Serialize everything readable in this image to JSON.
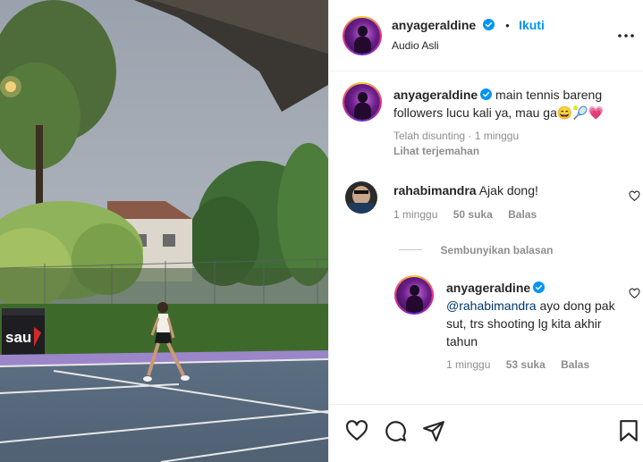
{
  "header": {
    "username": "anyageraldine",
    "follow_label": "Ikuti",
    "separator": "•",
    "audio_label": "Audio Asli"
  },
  "caption": {
    "username": "anyageraldine",
    "text": "main tennis bareng followers lucu kali ya, mau ga😄🎾💗",
    "edited_label": "Telah disunting",
    "time": "1 minggu",
    "translate_label": "Lihat terjemahan"
  },
  "comments": [
    {
      "username": "rahabimandra",
      "text": "Ajak dong!",
      "time": "1 minggu",
      "likes": "50 suka",
      "reply_label": "Balas"
    }
  ],
  "hide_replies_label": "Sembunyikan balasan",
  "replies": [
    {
      "username": "anyageraldine",
      "mention": "@rahabimandra",
      "text": "ayo dong pak sut, trs shooting lg kita akhir tahun",
      "time": "1 minggu",
      "likes": "53 suka",
      "reply_label": "Balas"
    }
  ],
  "media": {
    "banner_text": "sau"
  },
  "icons": {
    "verified": "verified-badge-icon",
    "more": "more-options-icon",
    "like": "heart-icon",
    "comment": "comment-bubble-icon",
    "share": "paper-plane-icon",
    "save": "bookmark-icon"
  },
  "colors": {
    "accent": "#0095f6",
    "mention": "#00376b",
    "muted": "#8e8e8e",
    "court": "#56677a",
    "court_border": "#9b86c9"
  }
}
